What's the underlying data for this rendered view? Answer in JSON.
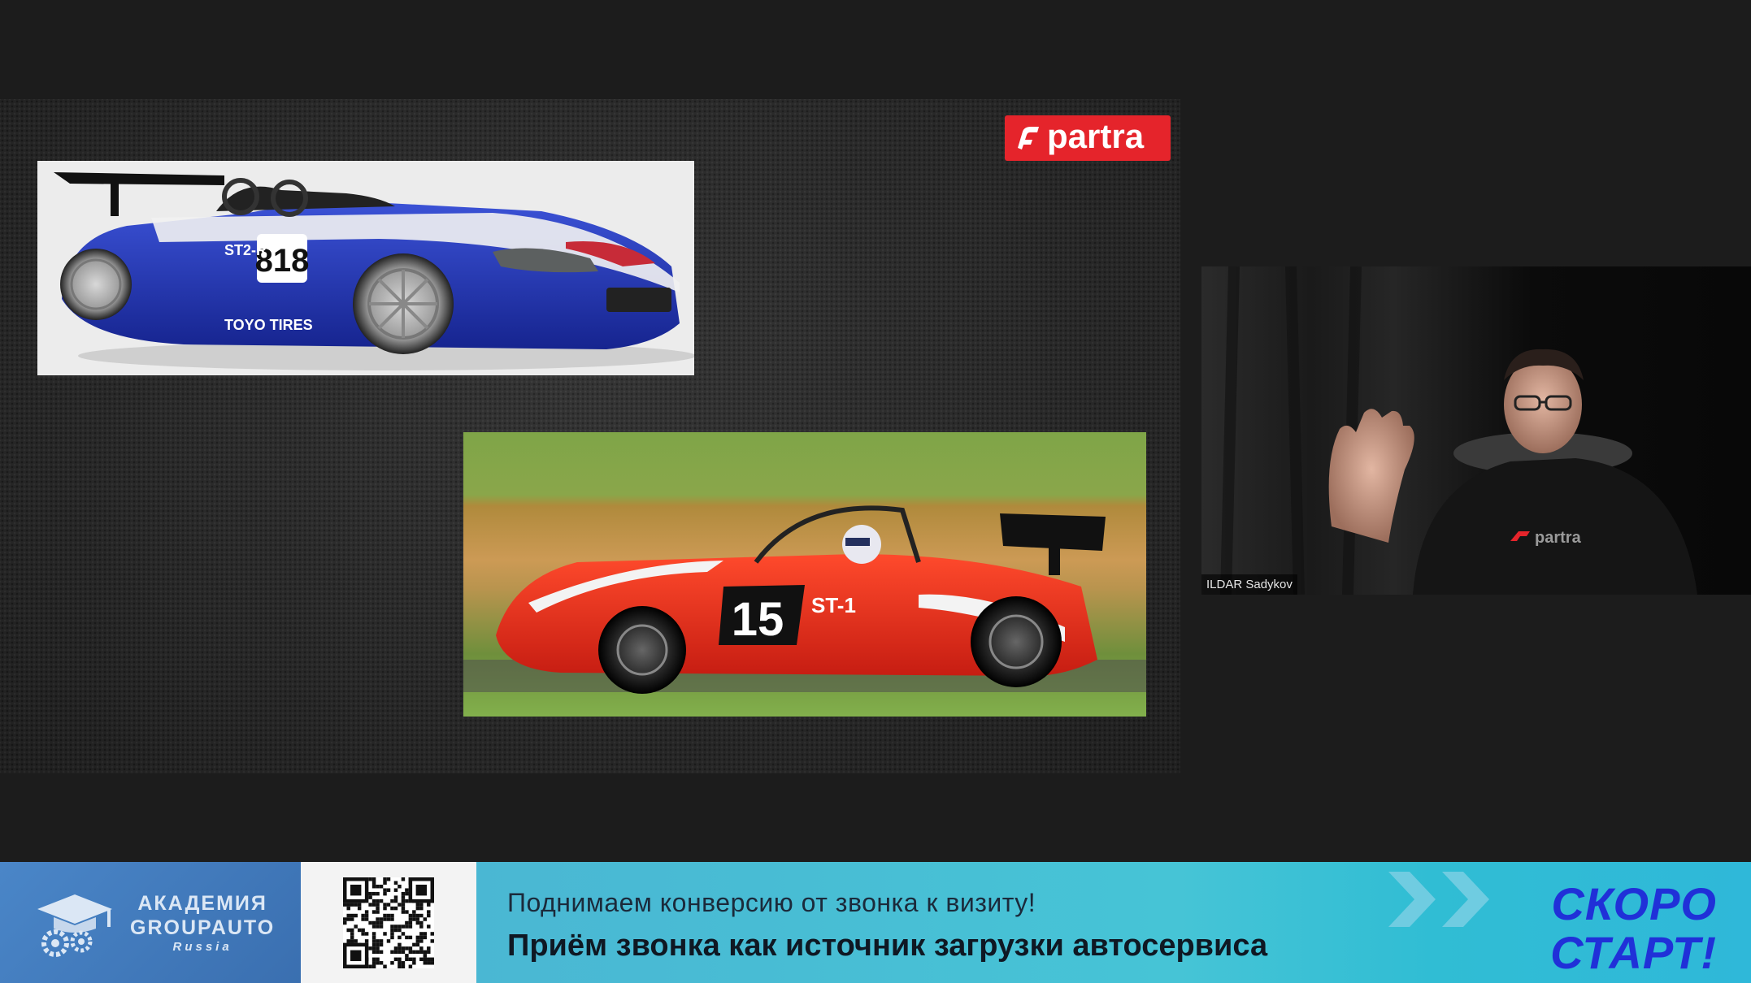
{
  "slide": {
    "brand": "partra",
    "photos": {
      "blue_car": {
        "race_number": "818",
        "class_label": "ST2-R",
        "sponsor": "TOYO TIRES"
      },
      "red_car": {
        "race_number": "15",
        "class_label": "ST-1"
      }
    },
    "colors": {
      "brand_red": "#e5242b",
      "slide_bg": "#2a2a2a"
    }
  },
  "video": {
    "speaker_name": "ILDAR Sadykov",
    "shirt_text": "partra"
  },
  "banner": {
    "academy": {
      "line1": "АКАДЕМИЯ",
      "line2": "GROUPAUTO",
      "line3": "Russia"
    },
    "qr_icon": "qr-code",
    "subtitle": "Поднимаем конверсию от звонка к визиту!",
    "title": "Приём звонка как источник загрузки автосервиса",
    "soon_line1": "СКОРО",
    "soon_line2": "СТАРТ!",
    "colors": {
      "academy_bg": "#3a6fb0",
      "headline_bg": "#46c4d6",
      "soon_text": "#2030d8"
    }
  }
}
